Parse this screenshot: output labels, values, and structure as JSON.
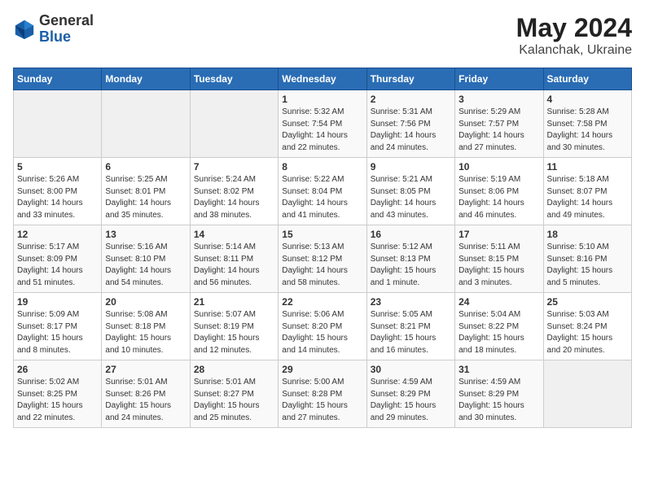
{
  "header": {
    "logo_general": "General",
    "logo_blue": "Blue",
    "title": "May 2024",
    "location": "Kalanchak, Ukraine"
  },
  "weekdays": [
    "Sunday",
    "Monday",
    "Tuesday",
    "Wednesday",
    "Thursday",
    "Friday",
    "Saturday"
  ],
  "weeks": [
    [
      {
        "day": "",
        "info": ""
      },
      {
        "day": "",
        "info": ""
      },
      {
        "day": "",
        "info": ""
      },
      {
        "day": "1",
        "info": "Sunrise: 5:32 AM\nSunset: 7:54 PM\nDaylight: 14 hours\nand 22 minutes."
      },
      {
        "day": "2",
        "info": "Sunrise: 5:31 AM\nSunset: 7:56 PM\nDaylight: 14 hours\nand 24 minutes."
      },
      {
        "day": "3",
        "info": "Sunrise: 5:29 AM\nSunset: 7:57 PM\nDaylight: 14 hours\nand 27 minutes."
      },
      {
        "day": "4",
        "info": "Sunrise: 5:28 AM\nSunset: 7:58 PM\nDaylight: 14 hours\nand 30 minutes."
      }
    ],
    [
      {
        "day": "5",
        "info": "Sunrise: 5:26 AM\nSunset: 8:00 PM\nDaylight: 14 hours\nand 33 minutes."
      },
      {
        "day": "6",
        "info": "Sunrise: 5:25 AM\nSunset: 8:01 PM\nDaylight: 14 hours\nand 35 minutes."
      },
      {
        "day": "7",
        "info": "Sunrise: 5:24 AM\nSunset: 8:02 PM\nDaylight: 14 hours\nand 38 minutes."
      },
      {
        "day": "8",
        "info": "Sunrise: 5:22 AM\nSunset: 8:04 PM\nDaylight: 14 hours\nand 41 minutes."
      },
      {
        "day": "9",
        "info": "Sunrise: 5:21 AM\nSunset: 8:05 PM\nDaylight: 14 hours\nand 43 minutes."
      },
      {
        "day": "10",
        "info": "Sunrise: 5:19 AM\nSunset: 8:06 PM\nDaylight: 14 hours\nand 46 minutes."
      },
      {
        "day": "11",
        "info": "Sunrise: 5:18 AM\nSunset: 8:07 PM\nDaylight: 14 hours\nand 49 minutes."
      }
    ],
    [
      {
        "day": "12",
        "info": "Sunrise: 5:17 AM\nSunset: 8:09 PM\nDaylight: 14 hours\nand 51 minutes."
      },
      {
        "day": "13",
        "info": "Sunrise: 5:16 AM\nSunset: 8:10 PM\nDaylight: 14 hours\nand 54 minutes."
      },
      {
        "day": "14",
        "info": "Sunrise: 5:14 AM\nSunset: 8:11 PM\nDaylight: 14 hours\nand 56 minutes."
      },
      {
        "day": "15",
        "info": "Sunrise: 5:13 AM\nSunset: 8:12 PM\nDaylight: 14 hours\nand 58 minutes."
      },
      {
        "day": "16",
        "info": "Sunrise: 5:12 AM\nSunset: 8:13 PM\nDaylight: 15 hours\nand 1 minute."
      },
      {
        "day": "17",
        "info": "Sunrise: 5:11 AM\nSunset: 8:15 PM\nDaylight: 15 hours\nand 3 minutes."
      },
      {
        "day": "18",
        "info": "Sunrise: 5:10 AM\nSunset: 8:16 PM\nDaylight: 15 hours\nand 5 minutes."
      }
    ],
    [
      {
        "day": "19",
        "info": "Sunrise: 5:09 AM\nSunset: 8:17 PM\nDaylight: 15 hours\nand 8 minutes."
      },
      {
        "day": "20",
        "info": "Sunrise: 5:08 AM\nSunset: 8:18 PM\nDaylight: 15 hours\nand 10 minutes."
      },
      {
        "day": "21",
        "info": "Sunrise: 5:07 AM\nSunset: 8:19 PM\nDaylight: 15 hours\nand 12 minutes."
      },
      {
        "day": "22",
        "info": "Sunrise: 5:06 AM\nSunset: 8:20 PM\nDaylight: 15 hours\nand 14 minutes."
      },
      {
        "day": "23",
        "info": "Sunrise: 5:05 AM\nSunset: 8:21 PM\nDaylight: 15 hours\nand 16 minutes."
      },
      {
        "day": "24",
        "info": "Sunrise: 5:04 AM\nSunset: 8:22 PM\nDaylight: 15 hours\nand 18 minutes."
      },
      {
        "day": "25",
        "info": "Sunrise: 5:03 AM\nSunset: 8:24 PM\nDaylight: 15 hours\nand 20 minutes."
      }
    ],
    [
      {
        "day": "26",
        "info": "Sunrise: 5:02 AM\nSunset: 8:25 PM\nDaylight: 15 hours\nand 22 minutes."
      },
      {
        "day": "27",
        "info": "Sunrise: 5:01 AM\nSunset: 8:26 PM\nDaylight: 15 hours\nand 24 minutes."
      },
      {
        "day": "28",
        "info": "Sunrise: 5:01 AM\nSunset: 8:27 PM\nDaylight: 15 hours\nand 25 minutes."
      },
      {
        "day": "29",
        "info": "Sunrise: 5:00 AM\nSunset: 8:28 PM\nDaylight: 15 hours\nand 27 minutes."
      },
      {
        "day": "30",
        "info": "Sunrise: 4:59 AM\nSunset: 8:29 PM\nDaylight: 15 hours\nand 29 minutes."
      },
      {
        "day": "31",
        "info": "Sunrise: 4:59 AM\nSunset: 8:29 PM\nDaylight: 15 hours\nand 30 minutes."
      },
      {
        "day": "",
        "info": ""
      }
    ]
  ]
}
